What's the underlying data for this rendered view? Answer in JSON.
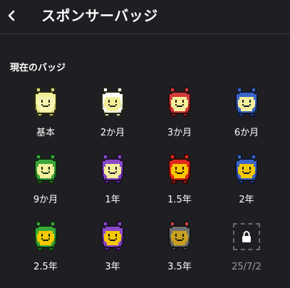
{
  "header": {
    "title": "スポンサーバッジ",
    "back_icon": "chevron-left-icon"
  },
  "section": {
    "title": "現在のバッジ"
  },
  "badges": [
    {
      "label": "基本",
      "head": "#f2ee9a",
      "face": "#f7f4b3",
      "shade": "#c9c36a",
      "outline": "#2a2a10",
      "antenna": "#d8d480",
      "status": "unlocked"
    },
    {
      "label": "2か月",
      "head": "#ffffff",
      "face": "#f2ee9a",
      "shade": "#d6d6d6",
      "outline": "#2a2a10",
      "antenna": "#ffffff",
      "status": "unlocked"
    },
    {
      "label": "3か月",
      "head": "#d33a3a",
      "face": "#f2ee9a",
      "shade": "#9c2020",
      "outline": "#2a0e0e",
      "antenna": "#d33a3a",
      "status": "unlocked"
    },
    {
      "label": "6か月",
      "head": "#3a64c8",
      "face": "#f2ee9a",
      "shade": "#23408c",
      "outline": "#0e1630",
      "antenna": "#3a64c8",
      "status": "unlocked"
    },
    {
      "label": "9か月",
      "head": "#3aa83a",
      "face": "#f2ee9a",
      "shade": "#21741f",
      "outline": "#0e2a0e",
      "antenna": "#3aa83a",
      "status": "unlocked"
    },
    {
      "label": "1年",
      "head": "#8a48c8",
      "face": "#f2ee9a",
      "shade": "#5a2a8c",
      "outline": "#1e0e30",
      "antenna": "#8a48c8",
      "status": "unlocked"
    },
    {
      "label": "1.5年",
      "head": "#e0281e",
      "face": "#f5c800",
      "shade": "#a81810",
      "outline": "#300a06",
      "antenna": "#e0281e",
      "status": "unlocked"
    },
    {
      "label": "2年",
      "head": "#3a64c8",
      "face": "#f5c800",
      "shade": "#23408c",
      "outline": "#0e1630",
      "antenna": "#3a64c8",
      "status": "unlocked"
    },
    {
      "label": "2.5年",
      "head": "#3aa83a",
      "face": "#f5c800",
      "shade": "#21741f",
      "outline": "#0e2a0e",
      "antenna": "#3aa83a",
      "status": "unlocked"
    },
    {
      "label": "3年",
      "head": "#8a48c8",
      "face": "#f5c800",
      "shade": "#5a2a8c",
      "outline": "#1e0e30",
      "antenna": "#8a48c8",
      "status": "unlocked"
    },
    {
      "label": "3.5年",
      "head": "#6e6e6e",
      "face": "#c8a020",
      "shade": "#454545",
      "outline": "#141414",
      "antenna": "#d04040",
      "status": "unlocked"
    },
    {
      "label": "25/7/2",
      "status": "locked",
      "icon": "lock-icon"
    }
  ],
  "colors": {
    "background": "#1f1f23",
    "divider": "#38383d",
    "text": "#ffffff",
    "muted_text": "#9a9aa2",
    "lock_border": "#6b6b72",
    "lock_icon": "#ffffff"
  }
}
